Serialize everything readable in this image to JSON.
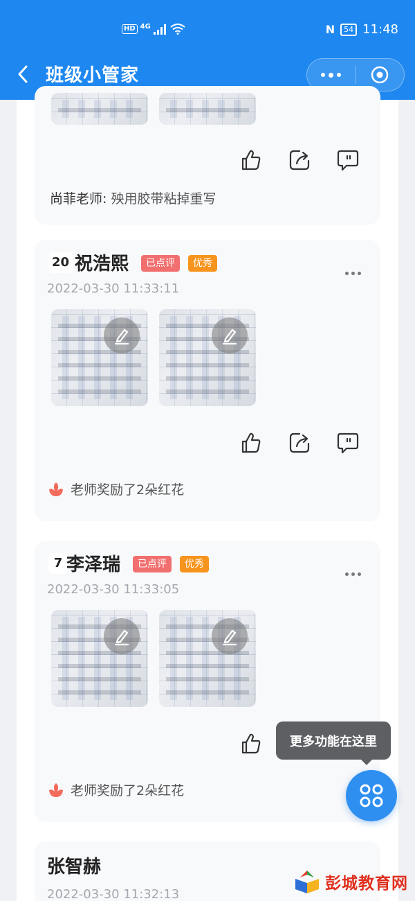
{
  "status_bar": {
    "network": "4G",
    "hd": "HD",
    "battery": "54",
    "time": "11:48"
  },
  "header": {
    "title": "班级小管家"
  },
  "posts": [
    {
      "comment_teacher": "尚菲老师:",
      "comment_text": "殃用胶带粘掉重写"
    },
    {
      "number": "20",
      "name": "祝浩熙",
      "tags": [
        "已点评",
        "优秀"
      ],
      "time": "2022-03-30 11:33:11",
      "reward": "老师奖励了2朵红花"
    },
    {
      "number": "7",
      "name": "李泽瑞",
      "tags": [
        "已点评",
        "优秀"
      ],
      "time": "2022-03-30 11:33:05",
      "reward": "老师奖励了2朵红花"
    },
    {
      "name": "张智赫",
      "time": "2022-03-30 11:32:13"
    }
  ],
  "fab": {
    "tooltip": "更多功能在这里"
  },
  "watermark": {
    "text": "彭城教育网"
  },
  "colors": {
    "primary": "#1e88f0",
    "tag_reviewed": "#f26f6f",
    "tag_excellent": "#f7941d"
  }
}
